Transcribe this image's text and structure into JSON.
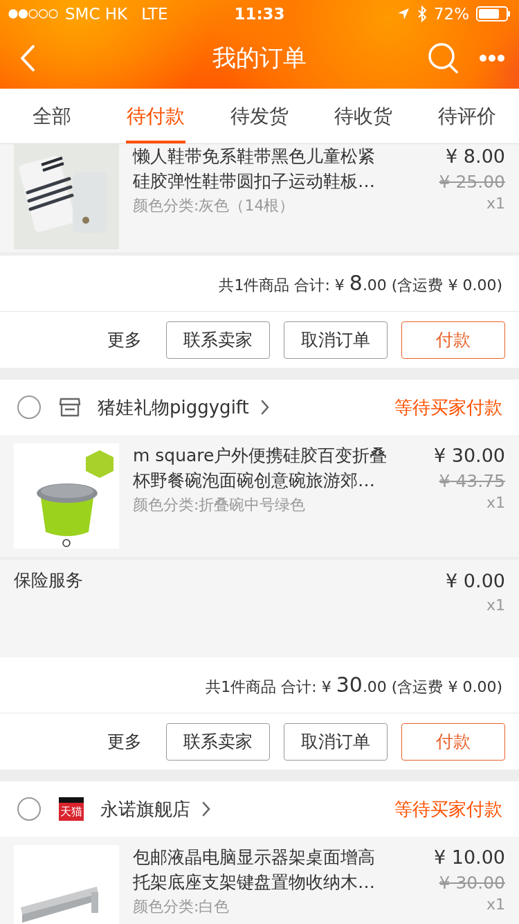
{
  "status_bar": {
    "carrier": "SMC HK",
    "network": "LTE",
    "time": "11:33",
    "battery": "72%"
  },
  "nav": {
    "title": "我的订单"
  },
  "tabs": [
    {
      "label": "全部",
      "selected": false
    },
    {
      "label": "待付款",
      "selected": true
    },
    {
      "label": "待发货",
      "selected": false
    },
    {
      "label": "待收货",
      "selected": false
    },
    {
      "label": "待评价",
      "selected": false
    }
  ],
  "orders": [
    {
      "items": [
        {
          "title_lines": [
            "懒人鞋带免系鞋带黑色儿童松紧",
            "硅胶弹性鞋带圆扣子运动鞋板…"
          ],
          "spec": "颜色分类:灰色（14根）",
          "price": "¥ 8.00",
          "original_price": "¥ 25.00",
          "quantity": "x1"
        }
      ],
      "summary": {
        "count": "共1件商品",
        "total_label": "合计:",
        "currency": "¥",
        "total_int": "8",
        "total_dec": ".00",
        "shipping": "(含运费 ¥ 0.00)"
      },
      "buttons": [
        {
          "label": "更多",
          "kind": "text"
        },
        {
          "label": "联系卖家",
          "kind": "outline"
        },
        {
          "label": "取消订单",
          "kind": "outline"
        },
        {
          "label": "付款",
          "kind": "primary"
        }
      ]
    },
    {
      "shop": {
        "name": "猪娃礼物piggygift",
        "kind": "store",
        "selected": false
      },
      "status": "等待买家付款",
      "items": [
        {
          "title_lines": [
            "m square户外便携硅胶百变折叠",
            "杯野餐碗泡面碗创意碗旅游郊…"
          ],
          "spec": "颜色分类:折叠碗中号绿色",
          "price": "¥ 30.00",
          "original_price": "¥ 43.75",
          "quantity": "x1"
        }
      ],
      "services": [
        {
          "name": "保险服务",
          "price": "¥ 0.00",
          "quantity": "x1"
        }
      ],
      "summary": {
        "count": "共1件商品",
        "total_label": "合计:",
        "currency": "¥",
        "total_int": "30",
        "total_dec": ".00",
        "shipping": "(含运费 ¥ 0.00)"
      },
      "buttons": [
        {
          "label": "更多",
          "kind": "text"
        },
        {
          "label": "联系卖家",
          "kind": "outline"
        },
        {
          "label": "取消订单",
          "kind": "outline"
        },
        {
          "label": "付款",
          "kind": "primary"
        }
      ]
    },
    {
      "shop": {
        "name": "永诺旗舰店",
        "kind": "tmall",
        "badge": "天猫",
        "selected": false
      },
      "status": "等待买家付款",
      "items": [
        {
          "title_lines": [
            "包邮液晶电脑显示器架桌面增高",
            "托架底座支架键盘置物收纳木…"
          ],
          "spec": "颜色分类:白色",
          "price": "¥ 10.00",
          "original_price": "¥ 30.00",
          "quantity": "x1"
        }
      ]
    }
  ]
}
